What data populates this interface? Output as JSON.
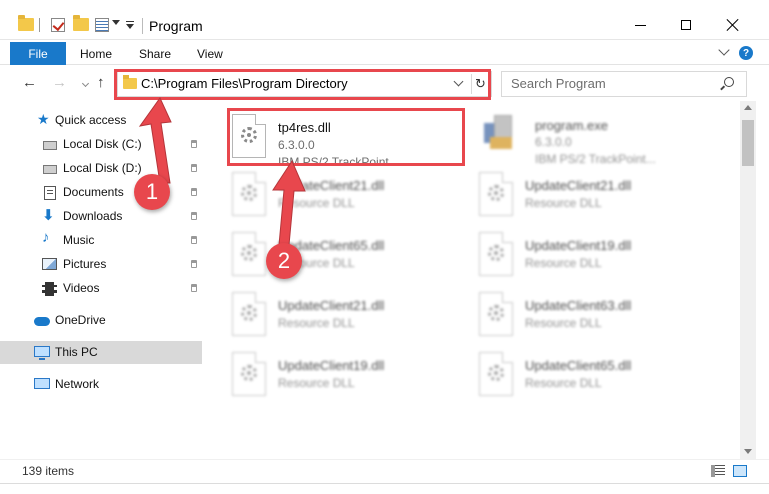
{
  "window": {
    "title": "Program"
  },
  "ribbon": {
    "tabs": [
      "File",
      "Home",
      "Share",
      "View"
    ],
    "help": "?"
  },
  "nav": {
    "back": "←",
    "forward": "→",
    "up": "↑"
  },
  "address": {
    "path": "C:\\Program Files\\Program Directory",
    "refresh": "↻"
  },
  "search": {
    "placeholder": "Search Program"
  },
  "sidebar": {
    "items": [
      {
        "label": "Quick access",
        "icon": "star-icon"
      },
      {
        "label": "Local Disk (C:)",
        "icon": "hard-drive-icon",
        "pinned": true
      },
      {
        "label": "Local Disk (D:)",
        "icon": "hard-drive-icon",
        "pinned": true
      },
      {
        "label": "Documents",
        "icon": "documents-icon",
        "pinned": true
      },
      {
        "label": "Downloads",
        "icon": "downloads-icon",
        "pinned": true
      },
      {
        "label": "Music",
        "icon": "music-icon",
        "pinned": true
      },
      {
        "label": "Pictures",
        "icon": "pictures-icon",
        "pinned": true
      },
      {
        "label": "Videos",
        "icon": "videos-icon",
        "pinned": true
      },
      {
        "label": "OneDrive",
        "icon": "cloud-icon"
      },
      {
        "label": "This PC",
        "icon": "computer-icon",
        "selected": true
      },
      {
        "label": "Network",
        "icon": "network-icon"
      }
    ]
  },
  "files": [
    {
      "name": "tp4res.dll",
      "line1": "6.3.0.0",
      "line2": "IBM PS/2 TrackPoint...",
      "icon": "dll-gear-icon"
    },
    {
      "name": "program.exe",
      "line1": "6.3.0.0",
      "line2": "IBM PS/2 TrackPoint...",
      "icon": "exe-icon"
    },
    {
      "name": "UpdateClient21.dll",
      "line1": "Resource DLL",
      "icon": "dll-gear-icon"
    },
    {
      "name": "UpdateClient21.dll",
      "line1": "Resource DLL",
      "icon": "dll-gear-icon"
    },
    {
      "name": "UpdateClient65.dll",
      "line1": "Resource DLL",
      "icon": "dll-gear-icon"
    },
    {
      "name": "UpdateClient19.dll",
      "line1": "Resource DLL",
      "icon": "dll-gear-icon"
    },
    {
      "name": "UpdateClient21.dll",
      "line1": "Resource DLL",
      "icon": "dll-gear-icon"
    },
    {
      "name": "UpdateClient63.dll",
      "line1": "Resource DLL",
      "icon": "dll-gear-icon"
    },
    {
      "name": "UpdateClient19.dll",
      "line1": "Resource DLL",
      "icon": "dll-gear-icon"
    },
    {
      "name": "UpdateClient65.dll",
      "line1": "Resource DLL",
      "icon": "dll-gear-icon"
    }
  ],
  "status": {
    "item_count": "139 items"
  },
  "annotations": {
    "badge1": "1",
    "badge2": "2",
    "color": "#e8474d"
  },
  "colors": {
    "accent": "#1979ca",
    "selection": "#d9d9d9"
  }
}
